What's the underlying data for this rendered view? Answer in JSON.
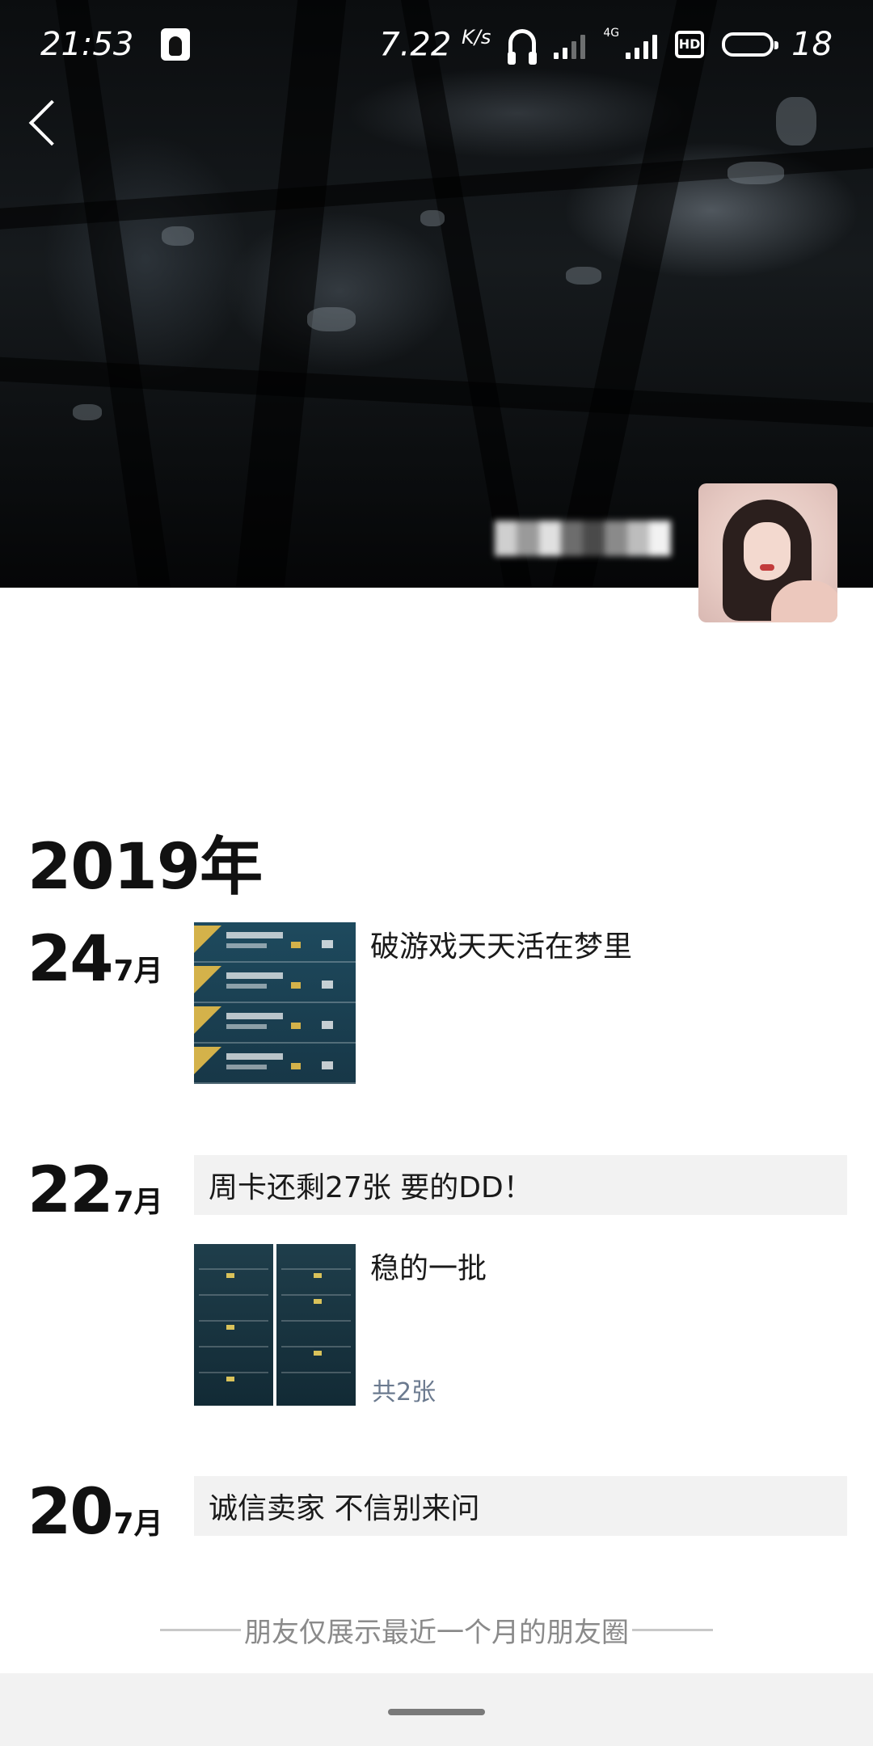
{
  "status_bar": {
    "time": "21:53",
    "net_speed": "7.22",
    "net_unit": "K/s",
    "network_type": "4G",
    "hd_label": "HD",
    "battery": "18"
  },
  "profile": {
    "cover_colors": {
      "dark": "#0b0d0f",
      "light": "#8c96a0"
    },
    "avatar_icon": "avatar-photo"
  },
  "feed": {
    "year": "2019年",
    "posts": [
      {
        "day": "24",
        "month": "7月",
        "text": "破游戏天天活在梦里"
      },
      {
        "day": "22",
        "month": "7月",
        "text_card": "周卡还剩27张 要的DD！",
        "text": "稳的一批",
        "photo_count": "共2张"
      },
      {
        "day": "20",
        "month": "7月",
        "text_card": "诚信卖家 不信别来问"
      }
    ]
  },
  "footer_note": "朋友仅展示最近一个月的朋友圈"
}
